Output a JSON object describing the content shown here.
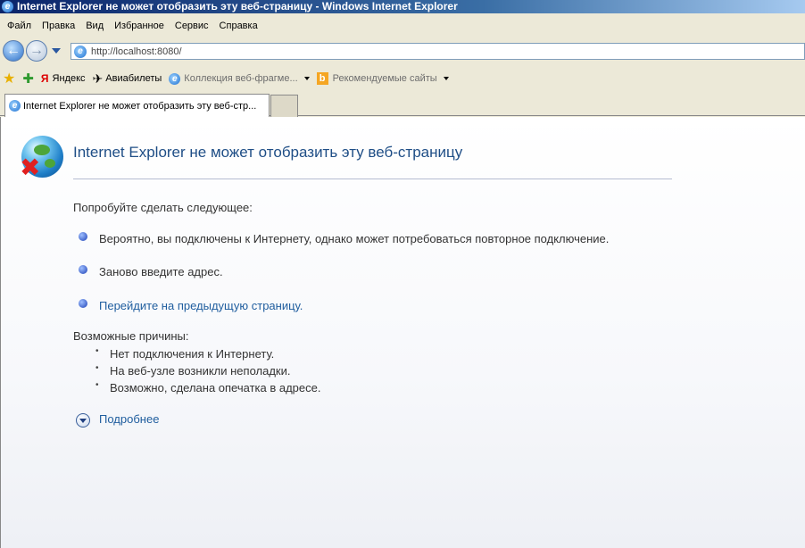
{
  "window": {
    "title": "Internet Explorer не может отобразить эту веб-страницу - Windows Internet Explorer"
  },
  "menu": [
    "Файл",
    "Правка",
    "Вид",
    "Избранное",
    "Сервис",
    "Справка"
  ],
  "address": {
    "url_host": "http://localhost",
    "url_rest": ":8080/"
  },
  "favorites": {
    "yandex": "Яндекс",
    "avia": "Авиабилеты",
    "gallery": "Коллекция веб-фрагме...",
    "recommended": "Рекомендуемые сайты"
  },
  "tab": {
    "label": "Internet Explorer не может отобразить эту веб-стр..."
  },
  "page": {
    "heading": "Internet Explorer не может отобразить эту веб-страницу",
    "try_label": "Попробуйте сделать следующее:",
    "suggestions": [
      "Вероятно, вы подключены к Интернету, однако может потребоваться повторное подключение.",
      "Заново введите адрес.",
      "Перейдите на предыдущую страницу."
    ],
    "reasons_label": "Возможные причины:",
    "reasons": [
      "Нет подключения к Интернету.",
      "На веб-узле возникли неполадки.",
      "Возможно, сделана опечатка в адресе."
    ],
    "more": "Подробнее"
  },
  "icons": {
    "browser": "ie-icon",
    "error": "globe-error-icon"
  }
}
